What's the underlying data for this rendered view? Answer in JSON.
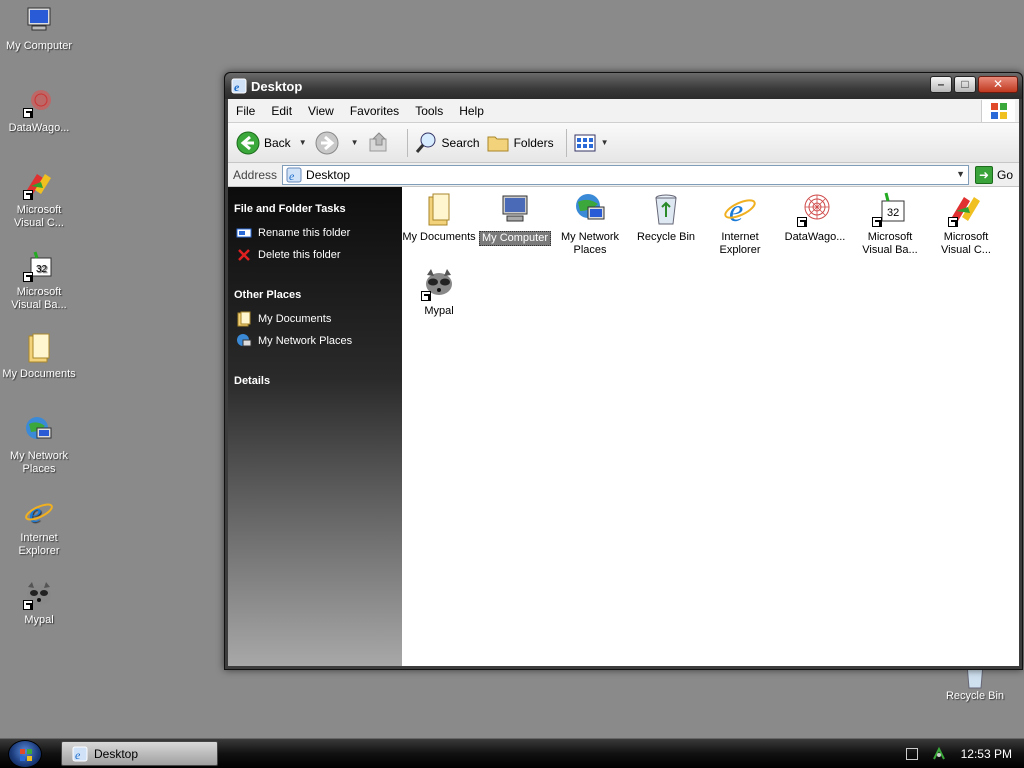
{
  "desktop": {
    "icons": [
      {
        "label": "My Computer",
        "icon": "my-computer-icon"
      },
      {
        "label": "DataWago...",
        "icon": "datawagon-icon"
      },
      {
        "label": "Microsoft Visual C...",
        "icon": "visual-c-icon"
      },
      {
        "label": "Microsoft Visual Ba...",
        "icon": "visual-basic-icon"
      },
      {
        "label": "My Documents",
        "icon": "my-documents-icon"
      },
      {
        "label": "My Network Places",
        "icon": "network-places-icon"
      },
      {
        "label": "Internet Explorer",
        "icon": "internet-explorer-icon"
      },
      {
        "label": "Mypal",
        "icon": "mypal-icon"
      },
      {
        "label": "Recycle Bin",
        "icon": "recycle-bin-icon"
      }
    ]
  },
  "window": {
    "title": "Desktop",
    "menu": [
      "File",
      "Edit",
      "View",
      "Favorites",
      "Tools",
      "Help"
    ],
    "toolbar": {
      "back_label": "Back",
      "search_label": "Search",
      "folders_label": "Folders"
    },
    "address": {
      "label": "Address",
      "value": "Desktop",
      "go_label": "Go"
    },
    "sidebar": {
      "tasks_title": "File and Folder Tasks",
      "tasks": [
        "Rename this folder",
        "Delete this folder"
      ],
      "other_title": "Other Places",
      "other": [
        "My Documents",
        "My Network Places"
      ],
      "details_title": "Details"
    },
    "items": [
      {
        "label": "My Documents",
        "icon": "my-documents-icon"
      },
      {
        "label": "My Computer",
        "icon": "my-computer-icon",
        "selected": true
      },
      {
        "label": "My Network Places",
        "icon": "network-places-icon"
      },
      {
        "label": "Recycle Bin",
        "icon": "recycle-bin-icon"
      },
      {
        "label": "Internet Explorer",
        "icon": "internet-explorer-icon"
      },
      {
        "label": "DataWago...",
        "icon": "datawagon-icon"
      },
      {
        "label": "Microsoft Visual Ba...",
        "icon": "visual-basic-icon"
      },
      {
        "label": "Microsoft Visual C...",
        "icon": "visual-c-icon"
      },
      {
        "label": "Mypal",
        "icon": "mypal-icon"
      }
    ]
  },
  "taskbar": {
    "task_label": "Desktop",
    "clock": "12:53 PM"
  }
}
